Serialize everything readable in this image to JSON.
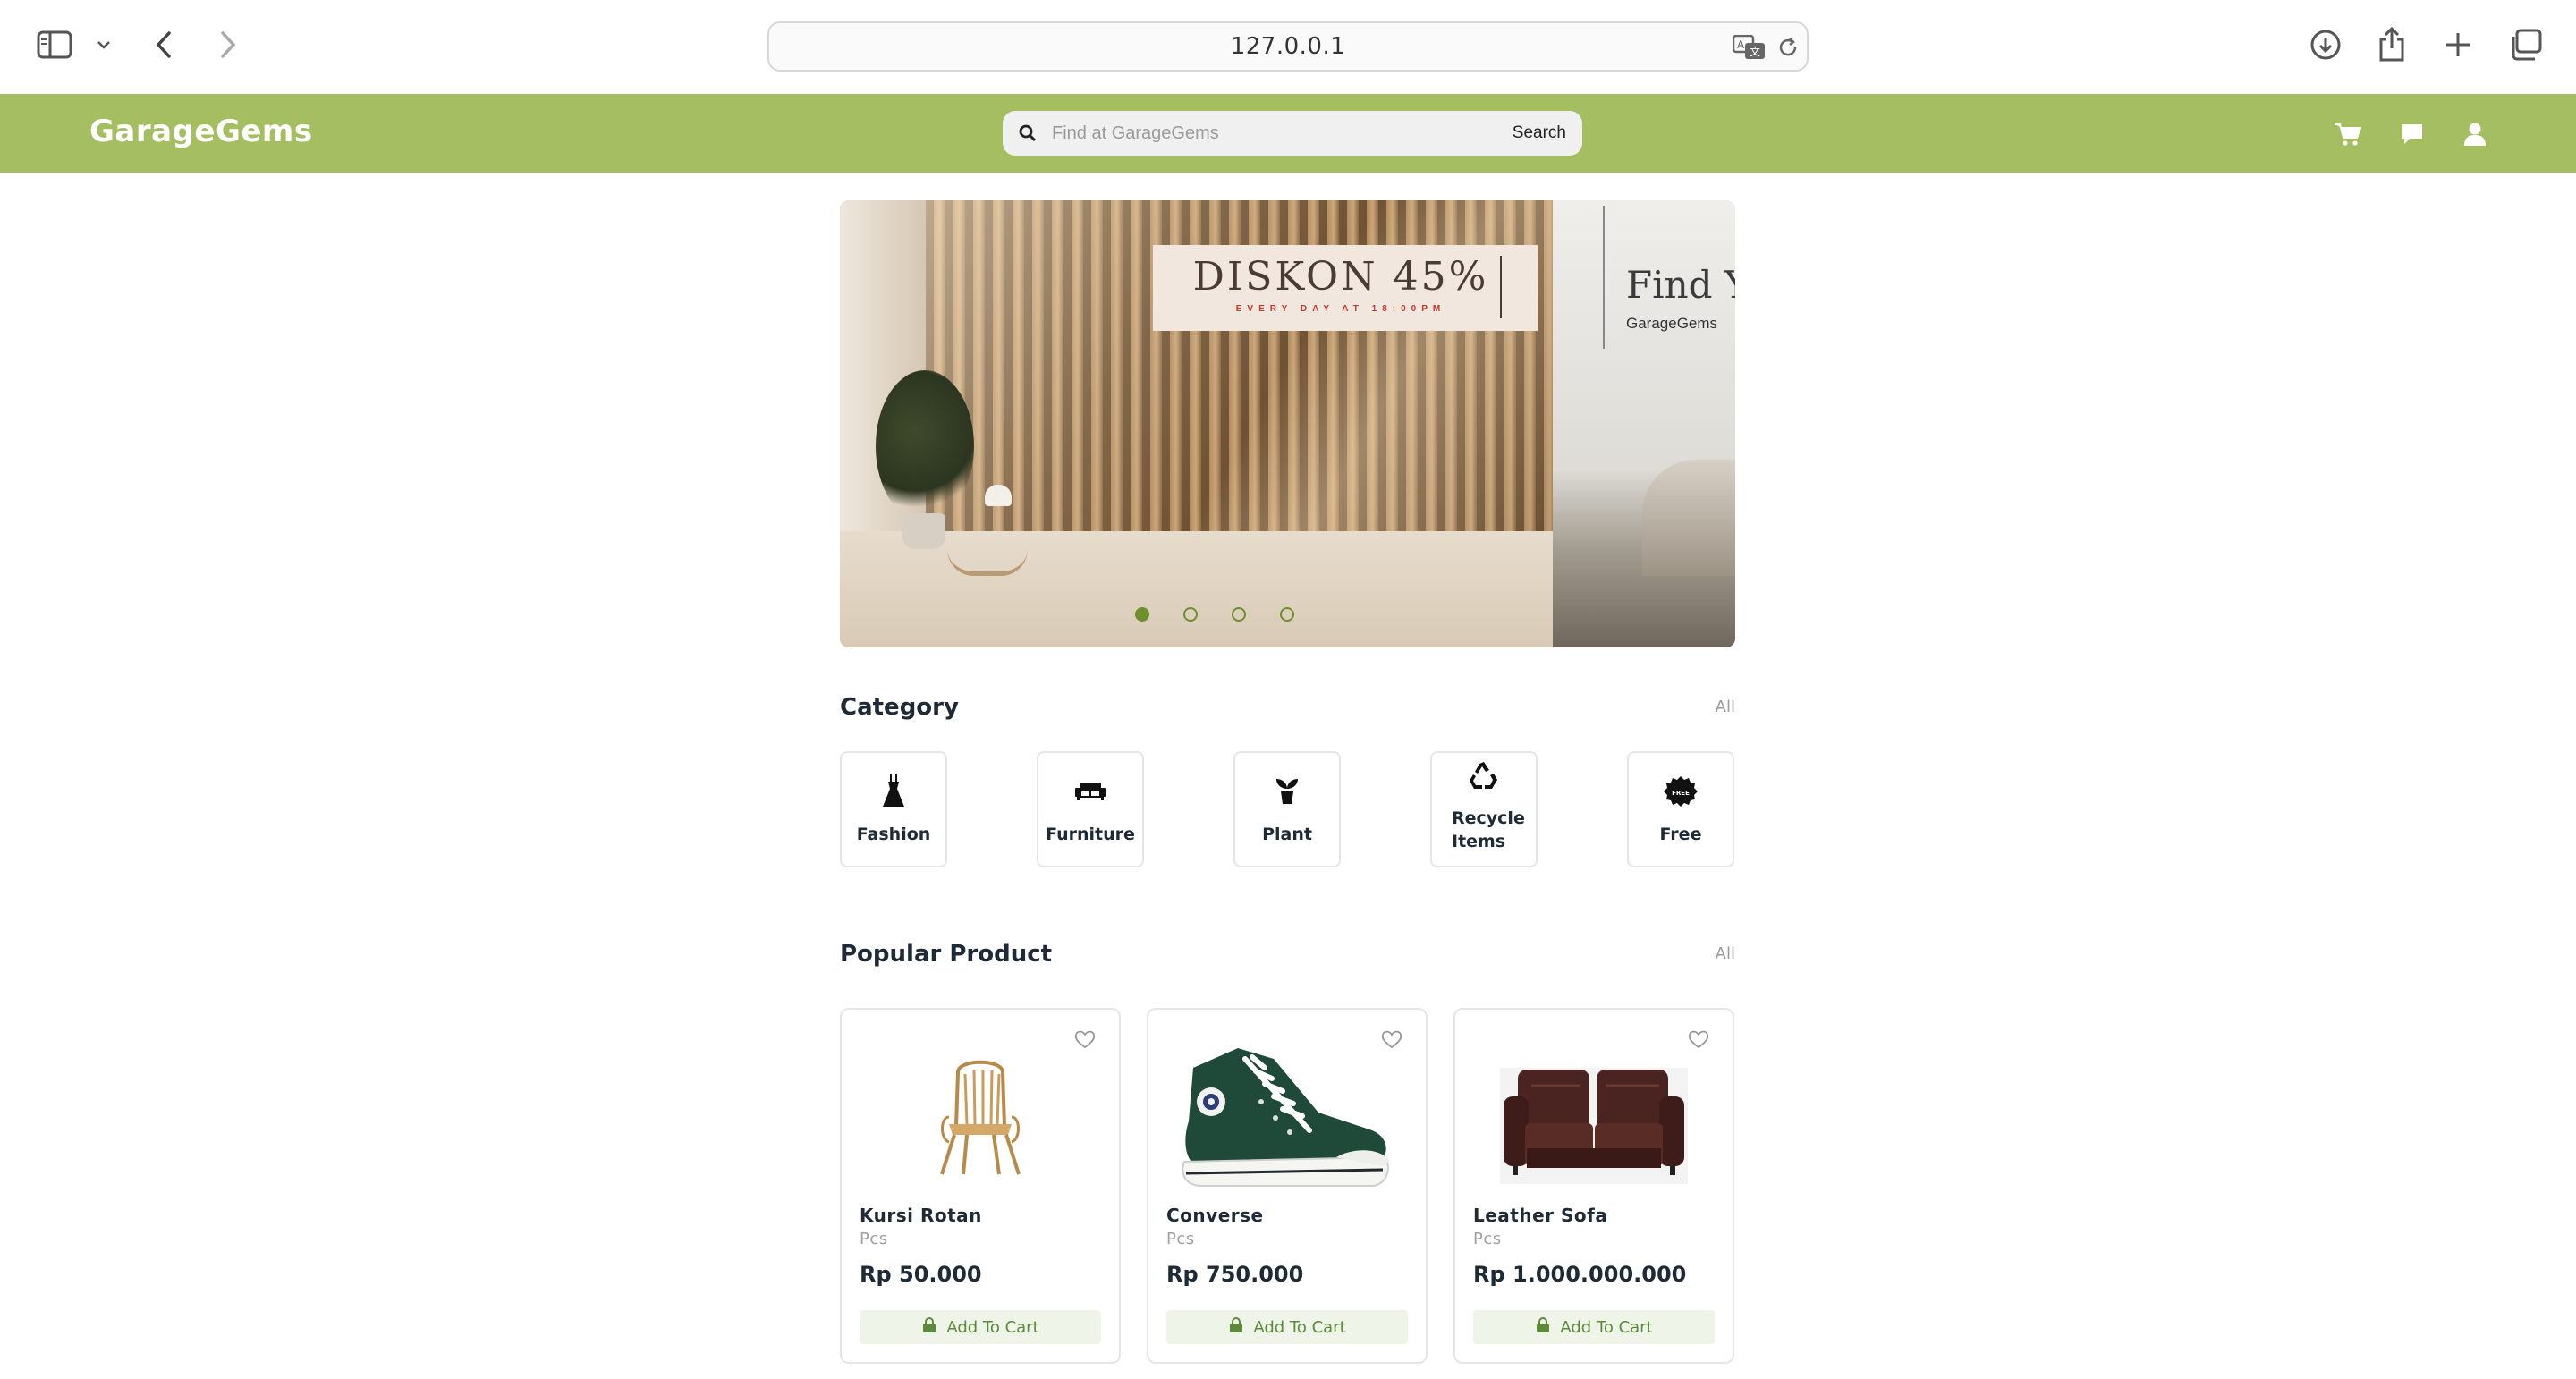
{
  "browser": {
    "url": "127.0.0.1",
    "icons": [
      "sidebar-icon",
      "chevron-down-icon",
      "back-icon",
      "forward-icon",
      "translate-icon",
      "reload-icon",
      "download-icon",
      "share-icon",
      "new-tab-icon",
      "tabs-overview-icon"
    ]
  },
  "header": {
    "brand": "GarageGems",
    "search_placeholder": "Find at GarageGems",
    "search_button": "Search",
    "icons": [
      "cart-icon",
      "chat-icon",
      "user-icon"
    ],
    "background_color": "#a5be62"
  },
  "banner": {
    "slide_main_title": "DISKON 45%",
    "slide_main_subtitle": "EVERY DAY AT 18:00PM",
    "slide_next_title": "Find Y",
    "slide_next_subtitle": "GarageGems",
    "dots": 4,
    "active_dot": 1,
    "accent_color": "#6e8f2d"
  },
  "categories": {
    "title": "Category",
    "see_all": "All",
    "items": [
      {
        "label": "Fashion",
        "icon": "dress-icon"
      },
      {
        "label": "Furniture",
        "icon": "sofa-icon"
      },
      {
        "label": "Plant",
        "icon": "plant-icon"
      },
      {
        "label": "Recycle Items",
        "icon": "recycle-icon"
      },
      {
        "label": "Free",
        "icon": "free-badge-icon"
      }
    ]
  },
  "popular": {
    "title": "Popular Product",
    "see_all": "All",
    "add_to_cart": "Add To Cart",
    "products": [
      {
        "name": "Kursi Rotan",
        "unit": "Pcs",
        "price": "Rp 50.000",
        "image": "rattan-chair"
      },
      {
        "name": "Converse",
        "unit": "Pcs",
        "price": "Rp 750.000",
        "image": "green-sneaker"
      },
      {
        "name": "Leather Sofa",
        "unit": "Pcs",
        "price": "Rp 1.000.000.000",
        "image": "leather-sofa"
      }
    ]
  }
}
